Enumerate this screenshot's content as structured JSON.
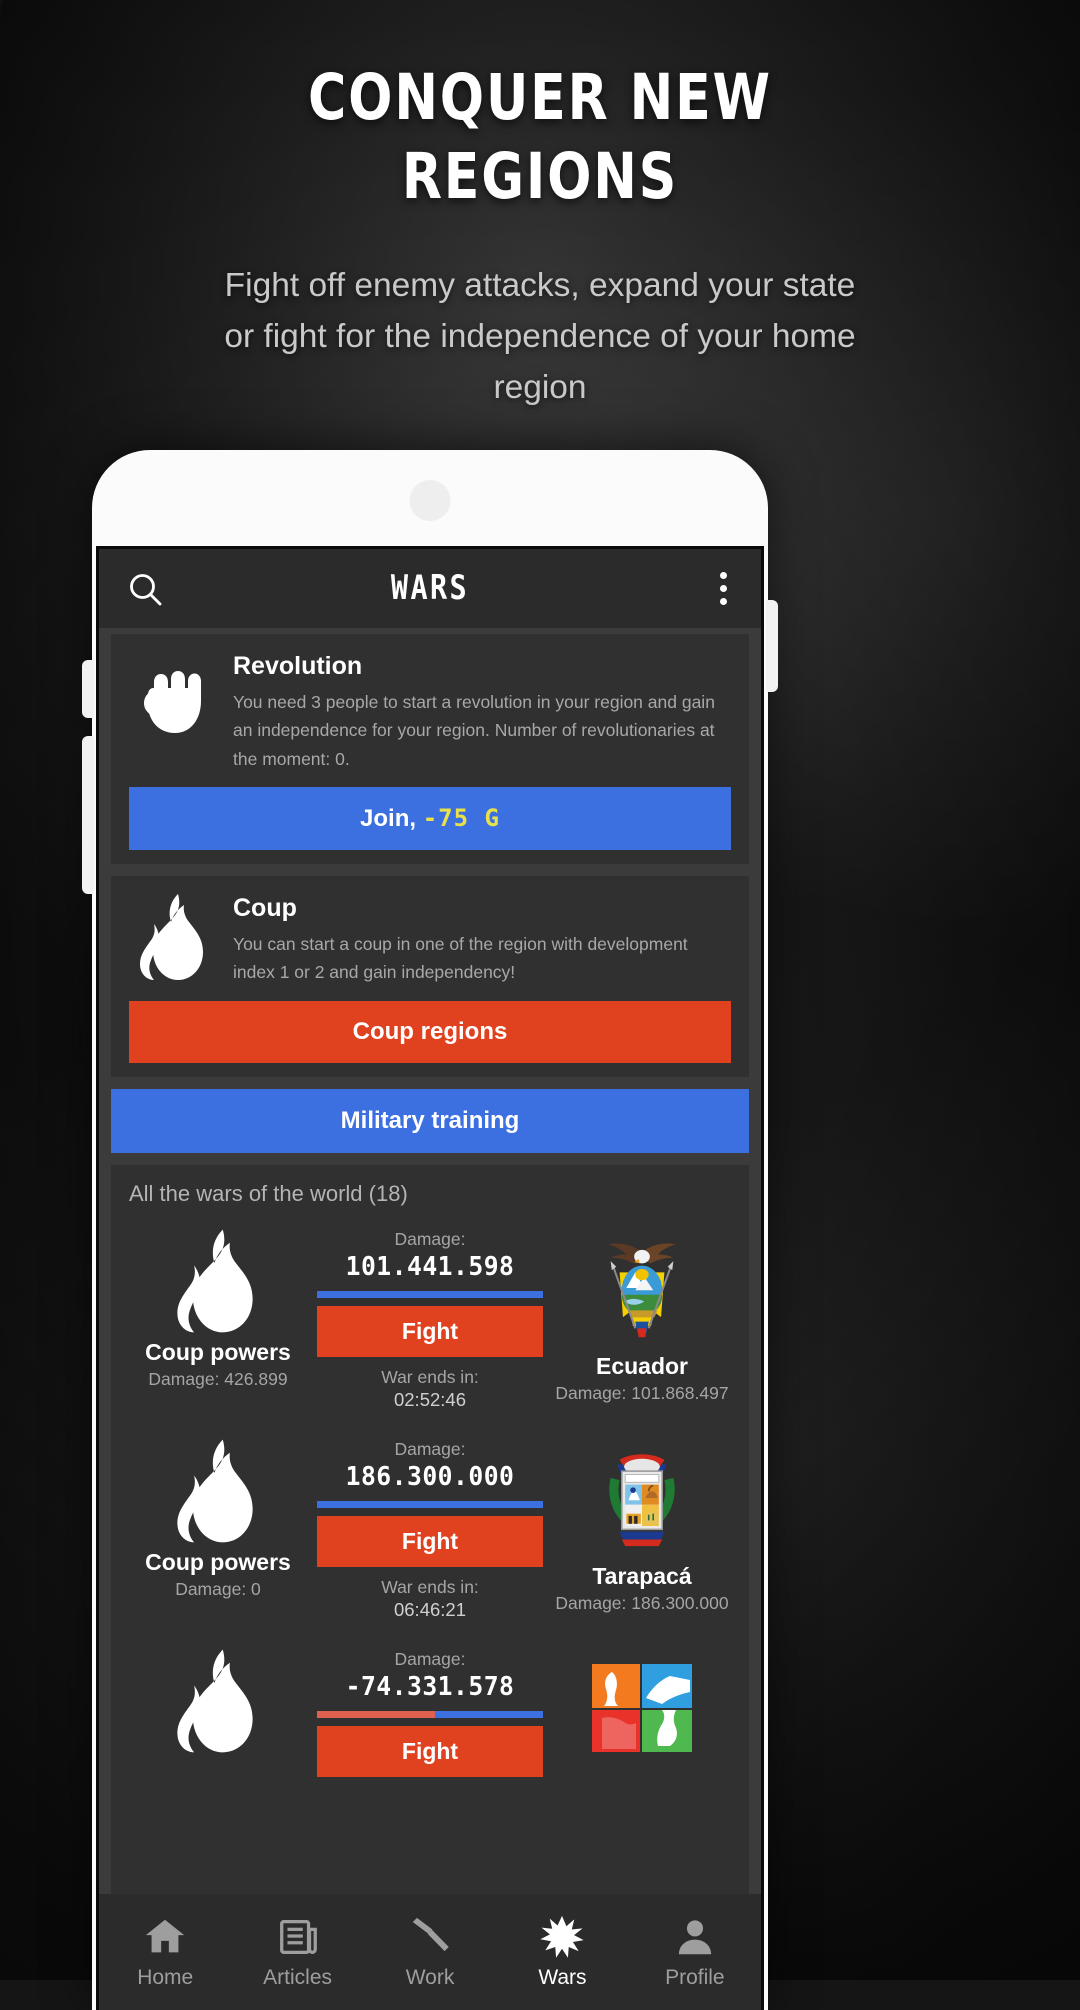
{
  "hero": {
    "title_line1": "Conquer New",
    "title_line2": "Regions",
    "subtitle": "Fight off enemy attacks, expand your state or fight for the independence of your home region"
  },
  "appbar": {
    "title": "Wars",
    "search_icon": "search-icon",
    "overflow_icon": "kebab-menu-icon"
  },
  "revolution": {
    "icon": "raised-fist-icon",
    "title": "Revolution",
    "description": "You need 3 people to start a revolution in your region and gain an independence for your region. Number of revolutionaries at the moment: 0.",
    "button_label": "Join, ",
    "button_cost": "-75 G",
    "button_color": "#3c6fe0",
    "cost_color": "#e8e14a"
  },
  "coup": {
    "icon": "flame-icon",
    "title": "Coup",
    "description": "You can start a coup in one of the region with development index 1 or 2 and gain independency!",
    "button_label": "Coup regions",
    "button_color": "#e0421f"
  },
  "military_training": {
    "label": "Military training",
    "color": "#3c6fe0"
  },
  "wars": {
    "heading": "All the wars of the world (18)",
    "count": 18,
    "rows": [
      {
        "left_icon": "flame-icon",
        "left_name": "Coup powers",
        "left_damage": "Damage: 426.899",
        "damage_label": "Damage:",
        "damage_value": "101.441.598",
        "bar_red_pct": 0,
        "bar_blue_pct": 100,
        "fight_label": "Fight",
        "ends_label": "War ends in:",
        "ends_time": "02:52:46",
        "right_icon": "ecuador-coat-of-arms",
        "right_name": "Ecuador",
        "right_damage": "Damage: 101.868.497"
      },
      {
        "left_icon": "flame-icon",
        "left_name": "Coup powers",
        "left_damage": "Damage: 0",
        "damage_label": "Damage:",
        "damage_value": "186.300.000",
        "bar_red_pct": 0,
        "bar_blue_pct": 100,
        "fight_label": "Fight",
        "ends_label": "War ends in:",
        "ends_time": "06:46:21",
        "right_icon": "tarapaca-coat-of-arms",
        "right_name": "Tarapacá",
        "right_damage": "Damage: 186.300.000"
      },
      {
        "left_icon": "flame-icon",
        "left_name": "",
        "left_damage": "",
        "damage_label": "Damage:",
        "damage_value": "-74.331.578",
        "bar_red_pct": 52,
        "bar_blue_pct": 48,
        "fight_label": "Fight",
        "ends_label": "",
        "ends_time": "",
        "right_icon": "region-flag-colorful",
        "right_name": "",
        "right_damage": ""
      }
    ]
  },
  "bottom_nav": {
    "items": [
      {
        "label": "Home",
        "icon": "home-icon",
        "active": false
      },
      {
        "label": "Articles",
        "icon": "articles-icon",
        "active": false
      },
      {
        "label": "Work",
        "icon": "hammer-icon",
        "active": false
      },
      {
        "label": "Wars",
        "icon": "star-burst-icon",
        "active": true
      },
      {
        "label": "Profile",
        "icon": "person-icon",
        "active": false
      }
    ]
  }
}
